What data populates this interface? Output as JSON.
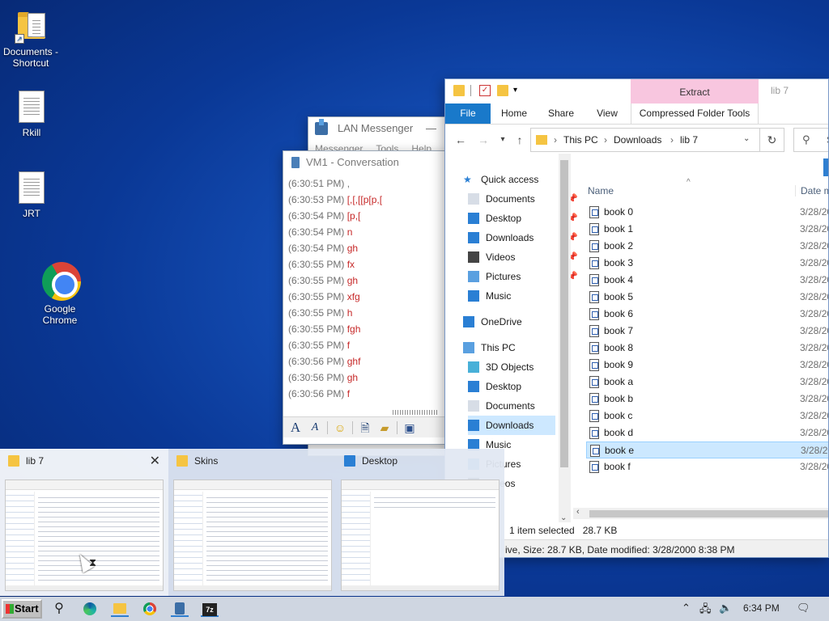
{
  "desktop": {
    "icons": [
      {
        "label": "Documents - Shortcut"
      },
      {
        "label": "Rkill"
      },
      {
        "label": "JRT"
      },
      {
        "label": "Google Chrome"
      }
    ]
  },
  "lan_messenger": {
    "title": "LAN Messenger",
    "menu": [
      "Messenger",
      "Tools",
      "Help"
    ]
  },
  "conversation": {
    "title": "VM1 - Conversation",
    "messages": [
      {
        "time": "(6:30:51 PM)",
        "text": ","
      },
      {
        "time": "(6:30:53 PM)",
        "text": "[,[,[[p[p,["
      },
      {
        "time": "(6:30:54 PM)",
        "text": "[p,["
      },
      {
        "time": "(6:30:54 PM)",
        "text": "n"
      },
      {
        "time": "(6:30:54 PM)",
        "text": "gh"
      },
      {
        "time": "(6:30:55 PM)",
        "text": "fx"
      },
      {
        "time": "(6:30:55 PM)",
        "text": "gh"
      },
      {
        "time": "(6:30:55 PM)",
        "text": "xfg"
      },
      {
        "time": "(6:30:55 PM)",
        "text": "h"
      },
      {
        "time": "(6:30:55 PM)",
        "text": "fgh"
      },
      {
        "time": "(6:30:55 PM)",
        "text": "f"
      },
      {
        "time": "(6:30:56 PM)",
        "text": "ghf"
      },
      {
        "time": "(6:30:56 PM)",
        "text": "gh"
      },
      {
        "time": "(6:30:56 PM)",
        "text": "f"
      }
    ],
    "toolbar_icons": [
      "font-icon",
      "font-color-icon",
      "smiley-icon",
      "attach-file-icon",
      "send-folder-icon",
      "save-icon"
    ]
  },
  "explorer": {
    "title": "lib 7",
    "contextual_tab": "Extract",
    "tabs": [
      "File",
      "Home",
      "Share",
      "View"
    ],
    "contextual_subtab": "Compressed Folder Tools",
    "breadcrumb": [
      "This PC",
      "Downloads",
      "lib 7"
    ],
    "search_placeholder": "S",
    "columns": {
      "name": "Name",
      "date": "Date m"
    },
    "nav": [
      {
        "label": "Quick access"
      },
      {
        "label": "Documents",
        "pinned": true
      },
      {
        "label": "Desktop",
        "pinned": true
      },
      {
        "label": "Downloads",
        "pinned": true
      },
      {
        "label": "Videos",
        "pinned": true
      },
      {
        "label": "Pictures",
        "pinned": true
      },
      {
        "label": "Music"
      },
      {
        "label": "OneDrive"
      },
      {
        "label": "This PC"
      },
      {
        "label": "3D Objects"
      },
      {
        "label": "Desktop"
      },
      {
        "label": "Documents"
      },
      {
        "label": "Downloads"
      },
      {
        "label": "Music"
      },
      {
        "label": "Pictures"
      },
      {
        "label": "Videos"
      }
    ],
    "files": [
      {
        "name": "book 0",
        "date": "3/28/20"
      },
      {
        "name": "book 1",
        "date": "3/28/20"
      },
      {
        "name": "book 2",
        "date": "3/28/20"
      },
      {
        "name": "book 3",
        "date": "3/28/20"
      },
      {
        "name": "book 4",
        "date": "3/28/20"
      },
      {
        "name": "book 5",
        "date": "3/28/20"
      },
      {
        "name": "book 6",
        "date": "3/28/20"
      },
      {
        "name": "book 7",
        "date": "3/28/20"
      },
      {
        "name": "book 8",
        "date": "3/28/20"
      },
      {
        "name": "book 9",
        "date": "3/28/20"
      },
      {
        "name": "book a",
        "date": "3/28/20"
      },
      {
        "name": "book b",
        "date": "3/28/20"
      },
      {
        "name": "book c",
        "date": "3/28/20"
      },
      {
        "name": "book d",
        "date": "3/28/20"
      },
      {
        "name": "book e",
        "date": "3/28/20",
        "selected": true
      },
      {
        "name": "book f",
        "date": "3/28/20"
      }
    ],
    "status": "1 item selected   28.7 KB",
    "info": "ive, Size: 28.7 KB, Date modified: 3/28/2000 8:38 PM"
  },
  "thumbnails": [
    {
      "title": "lib 7",
      "active": true
    },
    {
      "title": "Skins"
    },
    {
      "title": "Desktop"
    }
  ],
  "taskbar": {
    "start_label": "Start",
    "time": "6:34 PM"
  }
}
